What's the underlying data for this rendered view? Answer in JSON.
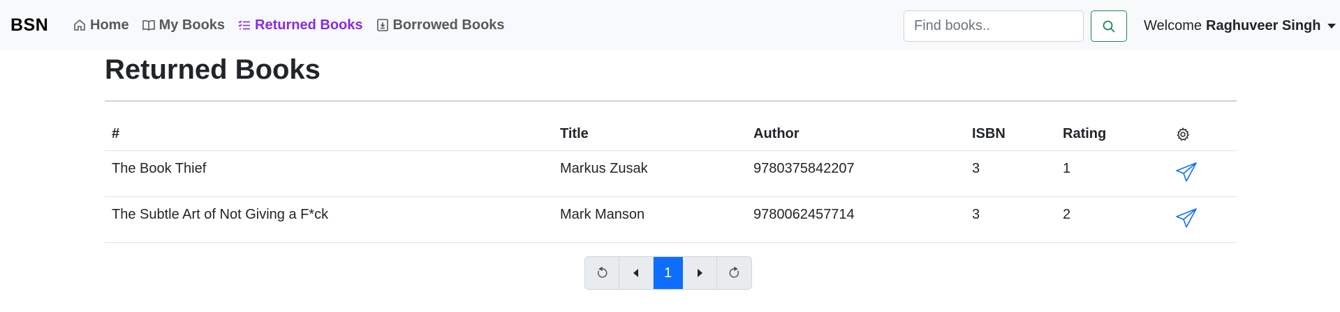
{
  "navbar": {
    "brand": "BSN",
    "links": [
      {
        "label": "Home",
        "icon": "house-icon"
      },
      {
        "label": "My Books",
        "icon": "book-open-icon"
      },
      {
        "label": "Returned Books",
        "icon": "list-check-icon",
        "active": true
      },
      {
        "label": "Borrowed Books",
        "icon": "file-download-icon"
      }
    ],
    "search_placeholder": "Find books..",
    "welcome_prefix": "Welcome",
    "user_name": "Raghuveer Singh"
  },
  "page": {
    "title": "Returned Books"
  },
  "table": {
    "headers": [
      "#",
      "Title",
      "Author",
      "ISBN",
      "Rating"
    ],
    "settings_icon": "gear-icon",
    "rows": [
      {
        "num": "The Book Thief",
        "title": "Markus Zusak",
        "author": "9780375842207",
        "isbn": "3",
        "rating": "1"
      },
      {
        "num": "The Subtle Art of Not Giving a F*ck",
        "title": "Mark Manson",
        "author": "9780062457714",
        "isbn": "3",
        "rating": "2"
      }
    ]
  },
  "pagination": {
    "current_page": "1",
    "controls": [
      "first-page-icon",
      "previous-page-icon",
      "next-page-icon",
      "last-page-icon"
    ]
  },
  "colors": {
    "active_nav": "#8a2be2",
    "search_border": "#198754",
    "primary": "#0d6efd"
  }
}
